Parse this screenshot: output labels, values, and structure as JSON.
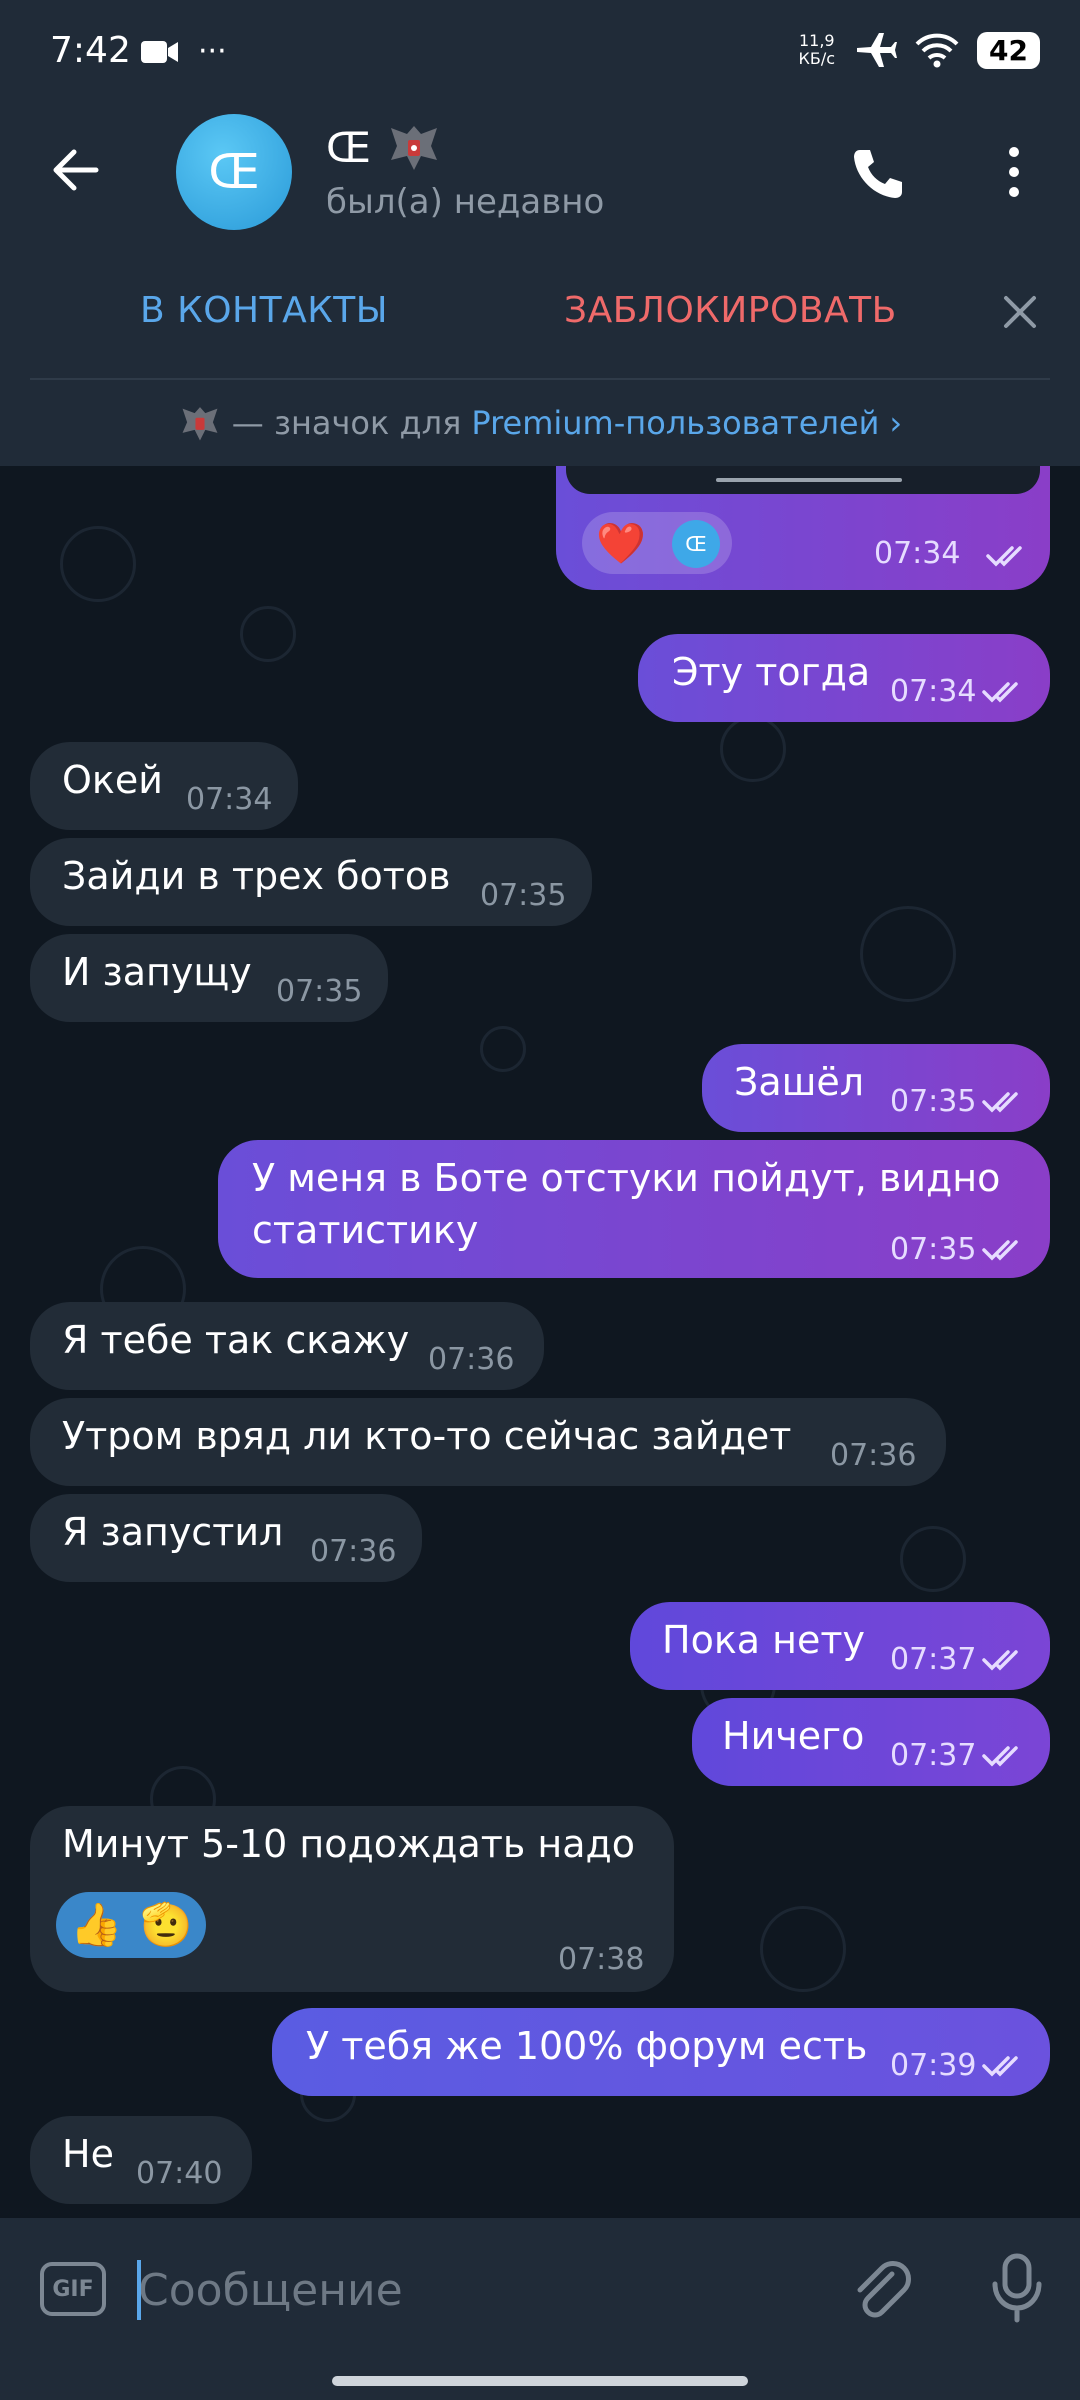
{
  "status_bar": {
    "time": "7:42",
    "more": "···",
    "speed_top": "11,9",
    "speed_unit": "КБ/с",
    "battery": "42"
  },
  "header": {
    "avatar_letter": "Œ",
    "title": "Œ",
    "subtitle": "был(а) недавно"
  },
  "actions": {
    "add_contact": "В КОНТАКТЫ",
    "block": "ЗАБЛОКИРОВАТЬ"
  },
  "premium": {
    "prefix": "— значок для",
    "link": "Premium-пользователей",
    "chevron": "›"
  },
  "messages": [
    {
      "dir": "out",
      "reactions": [
        "❤️",
        "Œ"
      ],
      "time": "07:34"
    },
    {
      "dir": "out",
      "text": "Эту тогда",
      "time": "07:34"
    },
    {
      "dir": "in",
      "text": "Окей",
      "time": "07:34"
    },
    {
      "dir": "in",
      "text": "Зайди в трех ботов",
      "time": "07:35"
    },
    {
      "dir": "in",
      "text": "И запущу",
      "time": "07:35"
    },
    {
      "dir": "out",
      "text": "Зашёл",
      "time": "07:35"
    },
    {
      "dir": "out",
      "text_line1": "У меня в Боте отстуки пойдут, видно",
      "text_line2": "статистику",
      "time": "07:35"
    },
    {
      "dir": "in",
      "text": "Я тебе так скажу",
      "time": "07:36"
    },
    {
      "dir": "in",
      "text": "Утром вряд ли кто-то сейчас зайдет",
      "time": "07:36"
    },
    {
      "dir": "in",
      "text": "Я запустил",
      "time": "07:36"
    },
    {
      "dir": "out",
      "text": "Пока нету",
      "time": "07:37"
    },
    {
      "dir": "out",
      "text": "Ничего",
      "time": "07:37"
    },
    {
      "dir": "in",
      "text": "Минут 5-10 подождать надо",
      "reactions": [
        "👍",
        "🫡"
      ],
      "time": "07:38"
    },
    {
      "dir": "out",
      "text": "У тебя же 100% форум есть",
      "time": "07:39"
    },
    {
      "dir": "in",
      "text": "Не",
      "time": "07:40"
    }
  ],
  "input": {
    "gif_label": "GIF",
    "placeholder": "Сообщение"
  },
  "colors": {
    "accent_blue": "#5aa7ea",
    "block_red": "#ef6a6a",
    "incoming_bubble": "#222c37",
    "outgoing_bubble": "#7a45d0",
    "header_bg": "#202b38",
    "chat_bg": "#0f1720"
  }
}
